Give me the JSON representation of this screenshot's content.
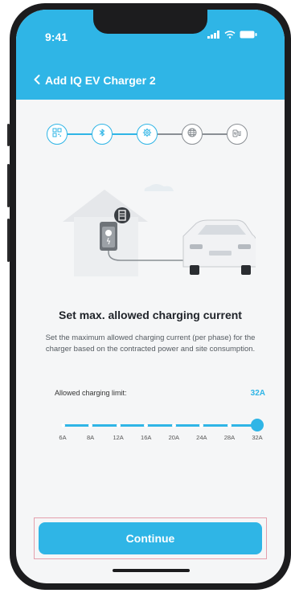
{
  "status_bar": {
    "time": "9:41"
  },
  "header": {
    "back_label": "Add IQ EV Charger 2"
  },
  "stepper": {
    "steps": [
      {
        "icon": "qr-code-icon",
        "state": "done"
      },
      {
        "icon": "bluetooth-icon",
        "state": "done"
      },
      {
        "icon": "settings-icon",
        "state": "active"
      },
      {
        "icon": "globe-icon",
        "state": "pending"
      },
      {
        "icon": "ev-charging-icon",
        "state": "pending"
      }
    ]
  },
  "content": {
    "title": "Set max. allowed charging current",
    "description": "Set the maximum allowed charging current (per phase) for the charger based on the contracted power and site consumption."
  },
  "slider": {
    "label": "Allowed charging limit:",
    "value_label": "32A",
    "ticks": [
      "6A",
      "8A",
      "12A",
      "16A",
      "20A",
      "24A",
      "28A",
      "32A"
    ],
    "selected_index": 7
  },
  "footer": {
    "continue_label": "Continue"
  },
  "colors": {
    "accent": "#2fb5e6",
    "background": "#f5f6f7",
    "text": "#1f2329"
  }
}
